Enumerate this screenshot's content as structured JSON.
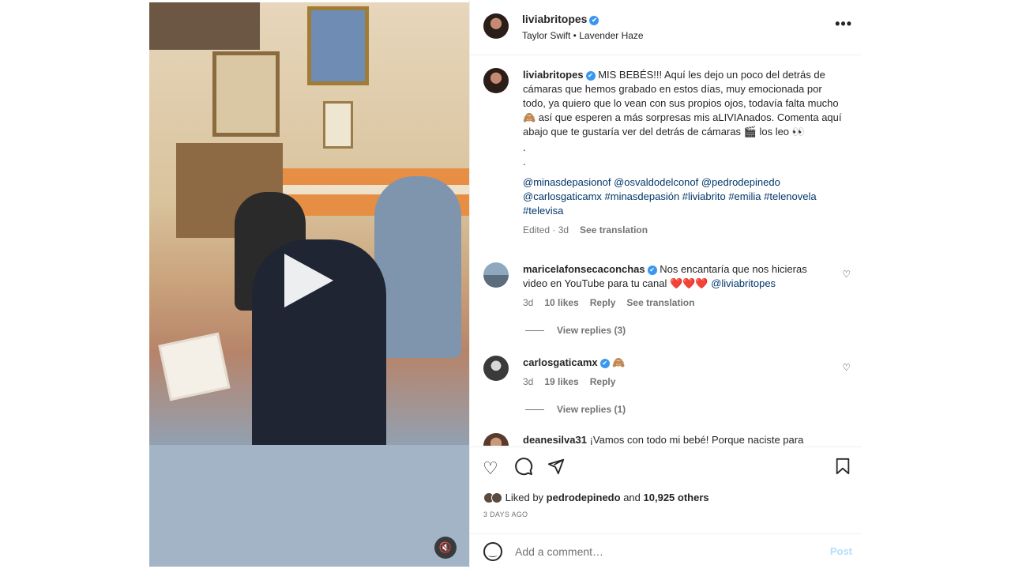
{
  "header": {
    "username": "liviabritopes",
    "verified_icon": "✔",
    "audio": "Taylor Swift • Lavender Haze",
    "more": "•••"
  },
  "caption": {
    "username": "liviabritopes",
    "text": "MIS BEBÉS!!! Aquí les dejo un poco del detrás de cámaras que hemos grabado en estos días, muy emocionada por todo, ya quiero que lo vean con sus propios ojos, todavía falta mucho 🙈 así que esperen a más sorpresas mis aLIVIAnados. Comenta aquí abajo que te gustaría ver del detrás de cámaras 🎬 los leo 👀",
    "dots": ".\n.",
    "tags": "@minasdepasionof @osvaldodelconof @pedrodepinedo @carlosgaticamx #minasdepasión #liviabrito #emilia #telenovela #televisa",
    "meta_time": "Edited · 3d",
    "see_translation": "See translation"
  },
  "comments": [
    {
      "username": "maricelafonsecaconchas",
      "text": "Nos encantaría que nos hicieras video en YouTube para tu canal",
      "hearts": "❤️❤️❤️",
      "mention": "@liviabritopes",
      "time": "3d",
      "likes": "10 likes",
      "reply": "Reply",
      "see_translation": "See translation",
      "view_replies": "View replies (3)"
    },
    {
      "username": "carlosgaticamx",
      "text": "🙈",
      "time": "3d",
      "likes": "19 likes",
      "reply": "Reply",
      "view_replies": "View replies (1)"
    },
    {
      "username": "deanesilva31",
      "text": "¡Vamos con todo mi bebé! Porque naciste para"
    }
  ],
  "actions": {
    "like_icon": "heart-outline",
    "comment_icon": "speech-bubble",
    "share_icon": "paper-plane",
    "save_icon": "bookmark"
  },
  "likes": {
    "prefix": "Liked by",
    "user": "pedrodepinedo",
    "conj": "and",
    "count": "10,925 others"
  },
  "date": "3 DAYS AGO",
  "comment_box": {
    "placeholder": "Add a comment…",
    "post_label": "Post"
  },
  "media": {
    "play_icon": "play-triangle",
    "mute_icon": "speaker-muted"
  }
}
